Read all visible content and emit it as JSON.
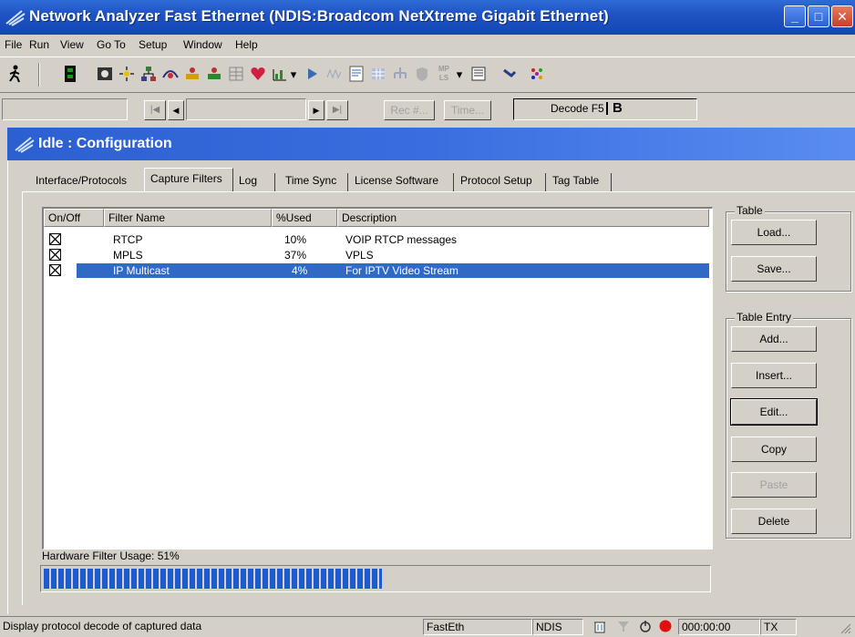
{
  "window": {
    "title": "Network Analyzer Fast Ethernet (NDIS:Broadcom NetXtreme Gigabit Ethernet)",
    "buttons": {
      "minimize": "_",
      "maximize": "□",
      "close": "✕"
    }
  },
  "menu": [
    {
      "label": "File"
    },
    {
      "label": "Run"
    },
    {
      "label": "View"
    },
    {
      "label": "Go To"
    },
    {
      "label": "Setup"
    },
    {
      "label": "Window"
    },
    {
      "label": "Help"
    }
  ],
  "toolbar": {
    "icons": [
      "run-icon",
      "stop-icon",
      "capture-icon",
      "filter-icon",
      "network-icon",
      "scan-icon",
      "traffic-icon",
      "expert-icon",
      "table-icon",
      "heart-icon",
      "stats-icon",
      "dropdown-icon",
      "play-icon",
      "wave-icon",
      "report-icon",
      "grid-icon",
      "tree-icon",
      "shield-icon",
      "mpls-icon",
      "dropdown-icon",
      "display-icon",
      "pointer-icon",
      "multi-icon"
    ],
    "mpls_label": "MP LS"
  },
  "navbar": {
    "rec_label": "Rec #...",
    "time_label": "Time...",
    "decode_label": "Decode F5",
    "decode_suffix": "B",
    "first_glyph": "|◀",
    "prev_glyph": "◀",
    "next_glyph": "▶",
    "last_glyph": "▶|"
  },
  "inner_window": {
    "title": "Idle : Configuration"
  },
  "tabs": [
    {
      "label": "Interface/Protocols"
    },
    {
      "label": "Capture Filters"
    },
    {
      "label": "Log"
    },
    {
      "label": "Time Sync"
    },
    {
      "label": "License Software"
    },
    {
      "label": "Protocol Setup"
    },
    {
      "label": "Tag Table"
    }
  ],
  "filters_table": {
    "columns": [
      "On/Off",
      "Filter Name",
      "%Used",
      "Description"
    ],
    "rows": [
      {
        "on": true,
        "name": "RTCP",
        "used": "10%",
        "description": "VOIP RTCP messages"
      },
      {
        "on": true,
        "name": "MPLS",
        "used": "37%",
        "description": "VPLS"
      },
      {
        "on": true,
        "name": "IP Multicast",
        "used": "4%",
        "description": "For IPTV Video Stream",
        "selected": true
      }
    ]
  },
  "table_group": {
    "label": "Table",
    "load": "Load...",
    "save": "Save..."
  },
  "entry_group": {
    "label": "Table Entry",
    "add": "Add...",
    "insert": "Insert...",
    "edit": "Edit...",
    "copy": "Copy",
    "paste": "Paste",
    "delete": "Delete"
  },
  "usage": {
    "label": "Hardware Filter Usage: 51%",
    "value": 0.51
  },
  "status": {
    "message": "Display protocol decode of captured data",
    "adapter": "FastEth",
    "driver": "NDIS",
    "timer": "000:00:00",
    "mode": "TX"
  },
  "colors": {
    "title_bar": "#1f54c4",
    "selection": "#316ac5",
    "usage_fill": "#1f5bd0",
    "record_dot": "#e01010"
  }
}
